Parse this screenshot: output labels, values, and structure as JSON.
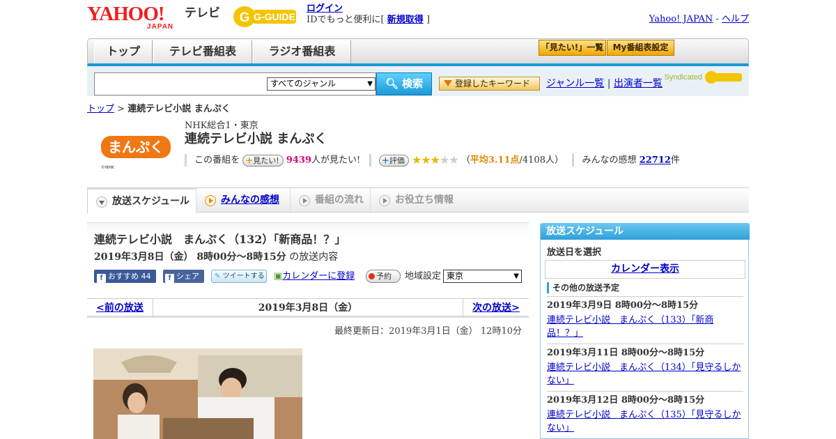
{
  "header": {
    "yahoo_logo": "YAHOO!",
    "yahoo_sub": "JAPAN",
    "tv_label": "テレビ",
    "gguide_logo": "G-GUIDE",
    "login": "ログイン",
    "login_text": "IDでもっと便利に[",
    "register": "新規取得",
    "login_close": "]",
    "yahoo_japan_link": "Yahoo! JAPAN",
    "sep": "-",
    "help_link": "ヘルプ"
  },
  "nav": {
    "tabs": [
      "トップ",
      "テレビ番組表",
      "ラジオ番組表"
    ],
    "mitai_list": "「見たい!」一覧",
    "my_schedule": "My番組表設定"
  },
  "search": {
    "placeholder": "",
    "genre": "すべてのジャンル",
    "button": "検索",
    "keyword_btn": "登録したキーワード",
    "genre_list": "ジャンル一覧",
    "divider": "|",
    "performer_list": "出演者一覧",
    "syndicated": "Syndicated"
  },
  "breadcrumb": {
    "top": "トップ",
    "sep": ">",
    "current": "連続テレビ小説 まんぷく"
  },
  "program": {
    "logo_text": "まんぷく",
    "logo_copy": "©NHK",
    "channel": "NHK総合1・東京",
    "title": "連続テレビ小説 まんぷく",
    "kono": "この番組を",
    "mitai_btn": "見たい!",
    "mitai_count": "9439",
    "mitai_suffix": "人が見たい!",
    "hyoka_btn": "評価",
    "avg_open": "（",
    "avg": "平均3.11点",
    "avg_people": "/4108人）",
    "kansou_label": "みんなの感想",
    "kansou_count": "22712",
    "kansou_suffix": "件"
  },
  "subtabs": {
    "schedule": "放送スケジュール",
    "kansou": "みんなの感想",
    "flow": "番組の流れ",
    "info": "お役立ち情報"
  },
  "episode": {
    "title": "連続テレビ小説　まんぷく（132）「新商品！？」",
    "date": "2019年3月8日（金） 8時00分～8時15分",
    "date_suffix": "の放送内容",
    "fb_recommend": "おすすめ",
    "fb_count": "44",
    "fb_share": "シェア",
    "tweet": "ツイートする",
    "calendar": "カレンダーに登録",
    "yoyaku": "予約",
    "region_label": "地域設定",
    "region": "東京"
  },
  "pager": {
    "prev": "<前の放送",
    "current": "2019年3月8日（金）",
    "next": "次の放送>"
  },
  "updated": "最終更新日：2019年3月1日（金） 12時10分",
  "sidebar": {
    "title": "放送スケジュール",
    "date_label": "放送日を選択",
    "calendar_btn": "カレンダー表示",
    "other_label": "その他の放送予定",
    "items": [
      {
        "date": "2019年3月9日 8時00分～8時15分",
        "title": "連続テレビ小説　まんぷく（133）「新商品！？」"
      },
      {
        "date": "2019年3月11日 8時00分～8時15分",
        "title": "連続テレビ小説　まんぷく（134）「見守るしかない」"
      },
      {
        "date": "2019年3月12日 8時00分～8時15分",
        "title": "連続テレビ小説　まんぷく（135）「見守るしかない」"
      }
    ]
  },
  "colors": {
    "brand_red": "#f01d1d",
    "accent_blue": "#1a9ad6",
    "orange": "#f0a800",
    "pink": "#e0007a"
  },
  "rating": {
    "stars": 3,
    "max": 5
  }
}
